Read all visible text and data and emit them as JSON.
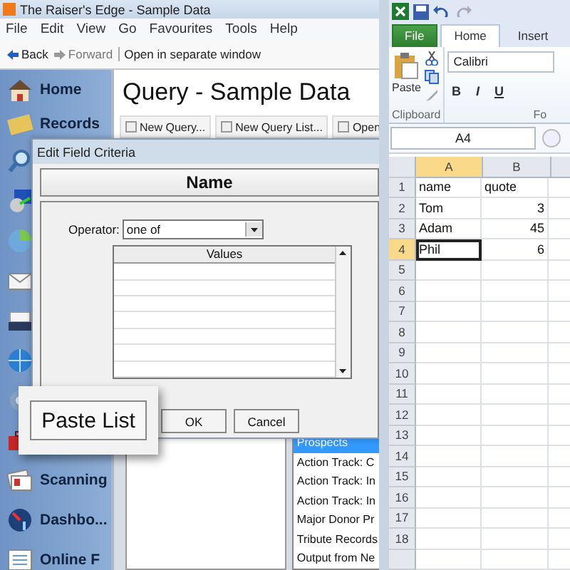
{
  "raisers_edge": {
    "title": "The Raiser's Edge - Sample Data",
    "menu": [
      "File",
      "Edit",
      "View",
      "Go",
      "Favourites",
      "Tools",
      "Help"
    ],
    "nav": {
      "back": "Back",
      "forward": "Forward",
      "open_separate": "Open in separate window"
    },
    "sidebar": [
      {
        "kind": "house",
        "label": "Home"
      },
      {
        "kind": "book",
        "label": "Records"
      },
      {
        "kind": "magnifier"
      },
      {
        "kind": "disc"
      },
      {
        "kind": "pie"
      },
      {
        "kind": "envelope"
      },
      {
        "kind": "printer"
      },
      {
        "kind": "globe"
      },
      {
        "kind": "gear"
      },
      {
        "kind": "toolbox"
      },
      {
        "kind": "cards",
        "label": "Scanning"
      },
      {
        "kind": "gauge",
        "label": "Dashbo..."
      },
      {
        "kind": "list",
        "label": "Online F"
      }
    ],
    "page_title": "Query - Sample Data",
    "toolbar": [
      "New Query...",
      "New Query List...",
      "Open"
    ],
    "list": [
      {
        "label": "Prospects",
        "selected": true
      },
      {
        "label": "Action Track: C",
        "selected": false
      },
      {
        "label": "Action Track: In",
        "selected": false
      },
      {
        "label": "Action Track: In",
        "selected": false
      },
      {
        "label": "Major Donor Pr",
        "selected": false
      },
      {
        "label": "Tribute Records",
        "selected": false
      },
      {
        "label": "Output from Ne",
        "selected": false
      }
    ]
  },
  "dialog": {
    "title": "Edit Field Criteria",
    "field": "Name",
    "operator_label": "Operator:",
    "operator_value": "one of",
    "values_header": "Values",
    "ok": "OK",
    "cancel": "Cancel"
  },
  "callout": {
    "button": "Paste List"
  },
  "excel": {
    "tabs": [
      {
        "label": "File",
        "kind": "file",
        "selected": false
      },
      {
        "label": "Home",
        "kind": "tab",
        "selected": true
      },
      {
        "label": "Insert",
        "kind": "tab",
        "selected": false
      }
    ],
    "paste": "Paste",
    "font": "Calibri",
    "format_buttons": [
      "B",
      "I",
      "U"
    ],
    "groups": [
      "Clipboard",
      "Fo"
    ],
    "name_box": "A4",
    "columns": [
      {
        "label": "A",
        "selected": true
      },
      {
        "label": "B",
        "selected": false
      }
    ],
    "rows": [
      {
        "number": "1",
        "selected": false,
        "cells": [
          {
            "text": "name",
            "kind": "text",
            "active": false
          },
          {
            "text": "quote",
            "kind": "text",
            "active": false
          }
        ]
      },
      {
        "number": "2",
        "selected": false,
        "cells": [
          {
            "text": "Tom",
            "kind": "text",
            "active": false
          },
          {
            "text": "3",
            "kind": "number",
            "active": false
          }
        ]
      },
      {
        "number": "3",
        "selected": false,
        "cells": [
          {
            "text": "Adam",
            "kind": "text",
            "active": false
          },
          {
            "text": "45",
            "kind": "number",
            "active": false
          }
        ]
      },
      {
        "number": "4",
        "selected": true,
        "cells": [
          {
            "text": "Phil",
            "kind": "text",
            "active": true
          },
          {
            "text": "6",
            "kind": "number",
            "active": false
          }
        ]
      },
      {
        "number": "5",
        "selected": false
      },
      {
        "number": "6",
        "selected": false
      },
      {
        "number": "7",
        "selected": false
      },
      {
        "number": "8",
        "selected": false
      },
      {
        "number": "9",
        "selected": false
      },
      {
        "number": "10",
        "selected": false
      },
      {
        "number": "11",
        "selected": false
      },
      {
        "number": "12",
        "selected": false
      },
      {
        "number": "13",
        "selected": false
      },
      {
        "number": "14",
        "selected": false
      },
      {
        "number": "15",
        "selected": false
      },
      {
        "number": "16",
        "selected": false
      },
      {
        "number": "17",
        "selected": false
      },
      {
        "number": "18",
        "selected": false
      }
    ]
  }
}
